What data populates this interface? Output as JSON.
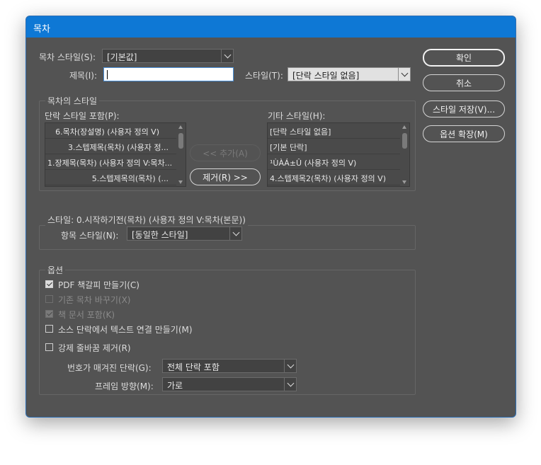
{
  "window": {
    "title": "목차"
  },
  "toc_style": {
    "label": "목차 스타일(S):",
    "value": "[기본값]"
  },
  "title_row": {
    "label": "제목(I):",
    "value": "",
    "style_label": "스타일(T):",
    "style_value": "[단락 스타일 없음]"
  },
  "styles_group": {
    "legend": "목차의 스타일",
    "include_label": "단락 스타일 포함(P):",
    "include_items": [
      "6.목차(장설명) (사용자 정의 V)",
      "3.스텝제목(목차) (사용자 정...",
      "1.장제목(목차) (사용자 정의 V:목차...",
      "5.스텝제목의(목차) (..."
    ],
    "add_button": "<< 추가(A)",
    "remove_button": "제거(R) >>",
    "other_label": "기타 스타일(H):",
    "other_items": [
      "[단락 스타일 없음]",
      "[기본 단락]",
      "¹ÙÀÁ±Û (사용자 정의 V)",
      "4.스텝제목2(목차) (사용자 정의 V)"
    ]
  },
  "style_group": {
    "legend": "스타일: 0.시작하기전(목차) (사용자 정의 V:목차(본문))",
    "entry_label": "항목 스타일(N):",
    "entry_value": "[동일한 스타일]"
  },
  "options_group": {
    "legend": "옵션",
    "checkboxes": [
      {
        "label": "PDF 책갈피 만들기(C)",
        "checked": true,
        "enabled": true
      },
      {
        "label": "기존 목차 바꾸기(X)",
        "checked": false,
        "enabled": false
      },
      {
        "label": "책 문서 포함(K)",
        "checked": true,
        "enabled": false
      },
      {
        "label": "소스 단락에서 텍스트 연결 만들기(M)",
        "checked": false,
        "enabled": true
      },
      {
        "label": "강제 줄바꿈 제거(R)",
        "checked": false,
        "enabled": true
      }
    ],
    "numbered_label": "번호가 매겨진 단락(G):",
    "numbered_value": "전체 단락 포함",
    "frame_label": "프레임 방향(M):",
    "frame_value": "가로"
  },
  "buttons": {
    "ok": "확인",
    "cancel": "취소",
    "save_style": "스타일 저장(V)...",
    "more_options": "옵션 확장(M)"
  },
  "colors": {
    "dialog_bg": "#535353",
    "title_bar": "#0e78d5"
  }
}
